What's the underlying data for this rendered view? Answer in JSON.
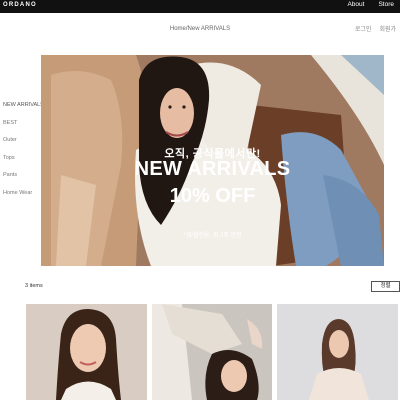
{
  "brand": {
    "logo": "ORDANO"
  },
  "topnav": {
    "about": "About",
    "store": "Store"
  },
  "breadcrumb": "Home/New ARRIVALS",
  "utility": {
    "login": "로그인",
    "join": "회원가"
  },
  "sidebar": {
    "items": [
      {
        "label": "NEW ARRIVALS",
        "active": true
      },
      {
        "label": "BEST"
      },
      {
        "label": "Outer"
      },
      {
        "label": "Tops"
      },
      {
        "label": "Pants"
      },
      {
        "label": "Home Wear"
      }
    ]
  },
  "hero": {
    "subtitle": "오직, 공식몰에서만!",
    "title": "NEW ARRIVALS",
    "discount": "10% OFF",
    "note": "*앱/웹전용, 최 2주 한정"
  },
  "listing": {
    "count": "3 items",
    "sort_label": "정렬"
  },
  "colors": {
    "topbar": "#111111",
    "hero_bg": "#a7836a"
  }
}
